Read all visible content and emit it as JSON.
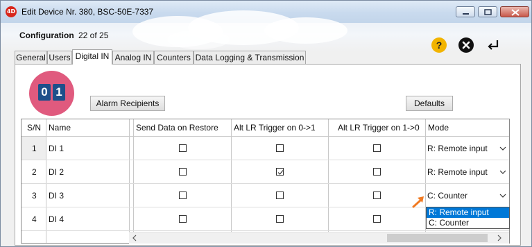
{
  "window": {
    "title": "Edit Device Nr. 380, BSC-50E-7337",
    "app_icon_text": "4D"
  },
  "header": {
    "config_label": "Configuration",
    "config_count": "22 of 25"
  },
  "toolbar": {
    "help_icon": "?"
  },
  "tabs": [
    {
      "label": "General",
      "active": false
    },
    {
      "label": "Users",
      "active": false
    },
    {
      "label": "Digital IN",
      "active": true
    },
    {
      "label": "Analog IN",
      "active": false
    },
    {
      "label": "Counters",
      "active": false
    },
    {
      "label": "Data Logging & Transmission",
      "active": false
    }
  ],
  "logo": {
    "digit1": "0",
    "digit2": "1"
  },
  "buttons": {
    "alarm_recipients": "Alarm Recipients",
    "defaults": "Defaults"
  },
  "table": {
    "columns": [
      "S/N",
      "Name",
      "Send Data on Restore",
      "Alt LR Trigger on 0->1",
      "Alt LR Trigger on 1->0",
      "Mode"
    ],
    "rows": [
      {
        "sn": "1",
        "name": "DI 1",
        "send_restore": false,
        "alt_0_1": false,
        "alt_1_0": false,
        "mode": "R: Remote input"
      },
      {
        "sn": "2",
        "name": "DI 2",
        "send_restore": false,
        "alt_0_1": true,
        "alt_1_0": false,
        "mode": "R: Remote input"
      },
      {
        "sn": "3",
        "name": "DI 3",
        "send_restore": false,
        "alt_0_1": false,
        "alt_1_0": false,
        "mode": "C: Counter"
      },
      {
        "sn": "4",
        "name": "DI 4",
        "send_restore": false,
        "alt_0_1": false,
        "alt_1_0": false,
        "mode": ""
      }
    ]
  },
  "mode_dropdown": {
    "options": [
      "R: Remote input",
      "C: Counter"
    ],
    "highlighted": "R: Remote input"
  },
  "colors": {
    "accent_orange": "#f07a22",
    "selection_blue": "#0078d7",
    "logo_pink": "#e05a7e"
  }
}
